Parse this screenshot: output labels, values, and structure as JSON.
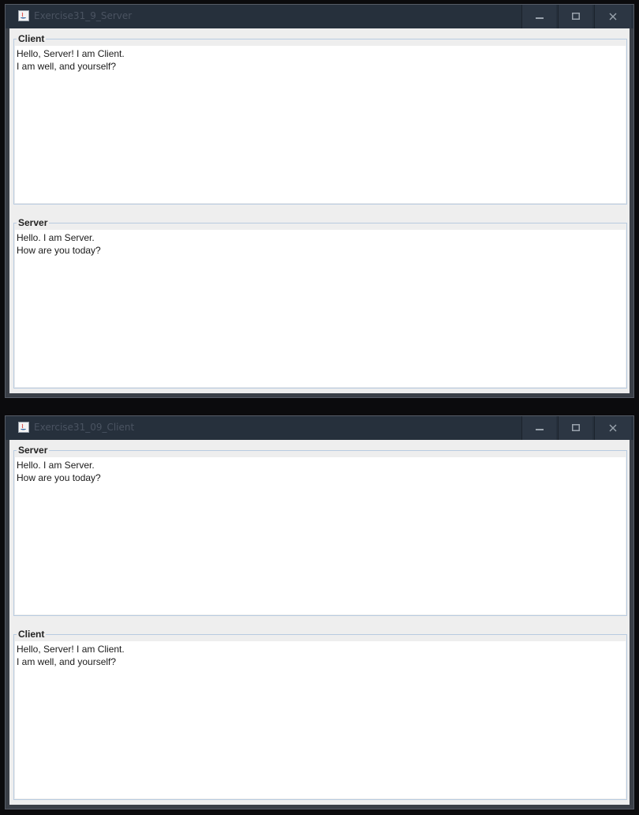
{
  "server_window": {
    "title": "Exercise31_9_Server",
    "controls": {
      "minimize_icon": "minimize-icon",
      "maximize_icon": "maximize-icon",
      "close_icon": "close-icon"
    },
    "panels": [
      {
        "label": "Client",
        "lines": [
          "Hello, Server! I am Client.",
          "I am well, and yourself?"
        ]
      },
      {
        "label": "Server",
        "lines": [
          "Hello. I am Server.",
          "How are you today?"
        ]
      }
    ]
  },
  "client_window": {
    "title": "Exercise31_09_Client",
    "controls": {
      "minimize_icon": "minimize-icon",
      "maximize_icon": "maximize-icon",
      "close_icon": "close-icon"
    },
    "panels": [
      {
        "label": "Server",
        "lines": [
          "Hello. I am Server.",
          "How are you today?"
        ]
      },
      {
        "label": "Client",
        "lines": [
          "Hello, Server! I am Client.",
          "I am well, and yourself?"
        ]
      }
    ]
  },
  "colors": {
    "titlebar": "#26303c",
    "panel_background": "#eeeeee",
    "panel_border": "#b8cbe0",
    "text": "#1a1a1a"
  }
}
